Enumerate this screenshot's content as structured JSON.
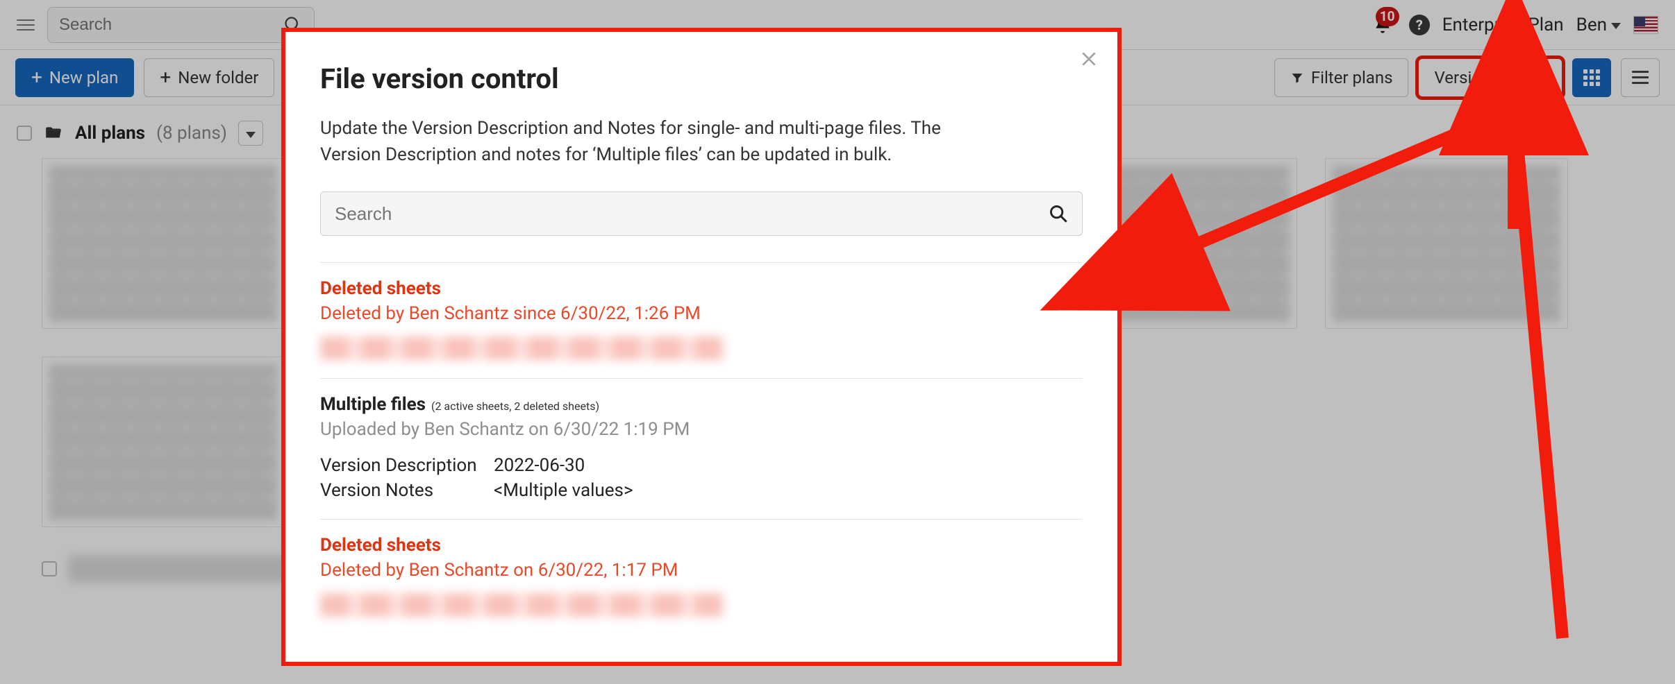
{
  "topnav": {
    "search_placeholder": "Search",
    "notification_count": "10",
    "plan": "Enterprise Plan",
    "user": "Ben"
  },
  "toolbar": {
    "new_plan": "New plan",
    "new_folder": "New folder",
    "filter": "Filter plans",
    "version_control": "Version control"
  },
  "plans_header": {
    "all_plans": "All plans",
    "count_label": "(8 plans)"
  },
  "modal": {
    "title": "File version control",
    "description": "Update the Version Description and Notes for single- and multi-page files. The Version Description and notes for ‘Multiple files’ can be updated in bulk.",
    "search_placeholder": "Search",
    "sections": [
      {
        "type": "deleted",
        "title": "Deleted sheets",
        "subtitle": "Deleted by Ben Schantz since 6/30/22, 1:26 PM"
      },
      {
        "type": "file",
        "title": "Multiple files",
        "paren": "(2 active sheets, 2 deleted sheets)",
        "subtitle": "Uploaded by Ben Schantz on 6/30/22 1:19 PM",
        "version_desc_label": "Version Description",
        "version_desc_value": "2022-06-30",
        "version_notes_label": "Version Notes",
        "version_notes_value": "<Multiple values>"
      },
      {
        "type": "deleted",
        "title": "Deleted sheets",
        "subtitle": "Deleted by Ben Schantz on 6/30/22, 1:17 PM"
      }
    ]
  }
}
